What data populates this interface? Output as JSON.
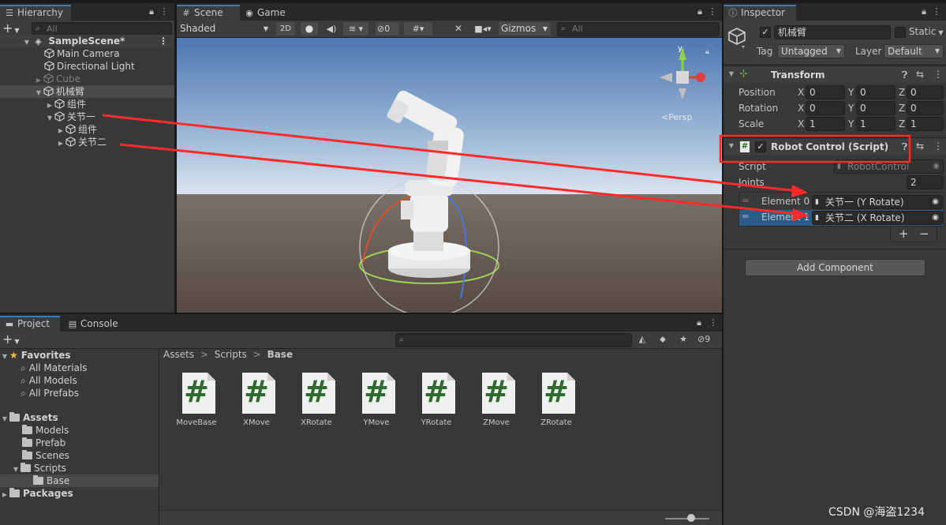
{
  "hierarchy": {
    "tab_label": "Hierarchy",
    "search_placeholder": "All",
    "scene_name": "SampleScene*",
    "items": [
      {
        "label": "Main Camera"
      },
      {
        "label": "Directional Light"
      },
      {
        "label": "Cube"
      },
      {
        "label": "机械臂"
      },
      {
        "label": "组件"
      },
      {
        "label": "关节一"
      },
      {
        "label": "组件"
      },
      {
        "label": "关节二"
      }
    ]
  },
  "scene": {
    "tabs": [
      {
        "label": "Scene"
      },
      {
        "label": "Game"
      }
    ],
    "shading_mode": "Shaded",
    "mode_2d": "2D",
    "hidden_count": "0",
    "gizmos_label": "Gizmos",
    "search_placeholder": "All",
    "gizmo_axis_y": "y",
    "gizmo_persp": "<Persp"
  },
  "inspector": {
    "tab_label": "Inspector",
    "object_name": "机械臂",
    "static_label": "Static",
    "tag_label": "Tag",
    "tag_value": "Untagged",
    "layer_label": "Layer",
    "layer_value": "Default",
    "transform": {
      "title": "Transform",
      "rows": [
        {
          "label": "Position",
          "x": "0",
          "y": "0",
          "z": "0"
        },
        {
          "label": "Rotation",
          "x": "0",
          "y": "0",
          "z": "0"
        },
        {
          "label": "Scale",
          "x": "1",
          "y": "1",
          "z": "1"
        }
      ],
      "axis_x": "X",
      "axis_y": "Y",
      "axis_z": "Z"
    },
    "robot_control": {
      "title": "Robot Control (Script)",
      "script_label": "Script",
      "script_value": "RobotControl",
      "joints_label": "Joints",
      "joints_count": "2",
      "elements": [
        {
          "label": "Element 0",
          "value": "关节一 (Y Rotate)"
        },
        {
          "label": "Element 1",
          "value": "关节二 (X Rotate)"
        }
      ],
      "add_symbol": "+",
      "remove_symbol": "−"
    },
    "add_component_label": "Add Component",
    "accent_red": "#ff2a2a"
  },
  "project": {
    "tabs": [
      {
        "label": "Project"
      },
      {
        "label": "Console"
      }
    ],
    "hidden_count": "9",
    "favorites_label": "Favorites",
    "favorites": [
      {
        "label": "All Materials"
      },
      {
        "label": "All Models"
      },
      {
        "label": "All Prefabs"
      }
    ],
    "assets_label": "Assets",
    "folders": [
      {
        "label": "Models"
      },
      {
        "label": "Prefab"
      },
      {
        "label": "Scenes"
      },
      {
        "label": "Scripts"
      },
      {
        "label": "Base"
      }
    ],
    "packages_label": "Packages",
    "breadcrumb": [
      {
        "label": "Assets"
      },
      {
        "label": "Scripts"
      },
      {
        "label": "Base"
      }
    ],
    "breadcrumb_sep": ">",
    "file_glyph": "#",
    "files": [
      {
        "name": "MoveBase"
      },
      {
        "name": "XMove"
      },
      {
        "name": "XRotate"
      },
      {
        "name": "YMove"
      },
      {
        "name": "YRotate"
      },
      {
        "name": "ZMove"
      },
      {
        "name": "ZRotate"
      }
    ]
  },
  "watermark": "CSDN @海盗1234"
}
